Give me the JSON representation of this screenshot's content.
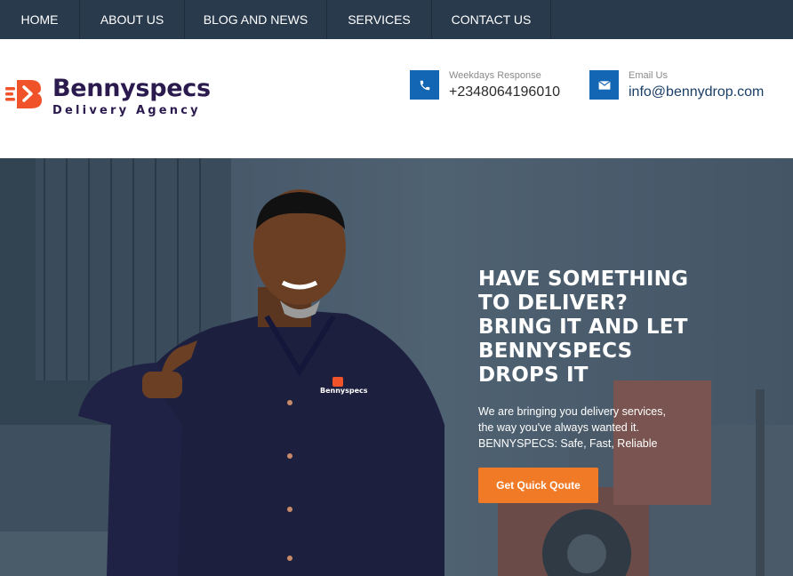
{
  "nav": {
    "items": [
      {
        "label": "HOME"
      },
      {
        "label": "ABOUT US"
      },
      {
        "label": "BLOG AND NEWS"
      },
      {
        "label": "SERVICES"
      },
      {
        "label": "CONTACT US"
      }
    ]
  },
  "header": {
    "brand": "Bennyspecs",
    "tagline": "Delivery Agency",
    "phone": {
      "label": "Weekdays Response",
      "value": "+2348064196010",
      "icon": "phone-icon"
    },
    "email": {
      "label": "Email Us",
      "value": "info@bennydrop.com",
      "icon": "envelope-icon"
    }
  },
  "hero": {
    "headline": [
      "HAVE SOMETHING",
      "TO DELIVER?",
      "BRING IT AND LET",
      "BENNYSPECS",
      "DROPS IT"
    ],
    "subtext": [
      "We are bringing you delivery services,",
      "the way you've always wanted it.",
      "BENNYSPECS: Safe, Fast, Reliable"
    ],
    "cta_label": "Get Quick Qoute",
    "shirt_logo": "Bennyspecs"
  },
  "colors": {
    "nav_bg": "#2a3a4d",
    "brand": "#2b1a4e",
    "accent_orange": "#f07a26",
    "icon_blue": "#1366b3"
  }
}
